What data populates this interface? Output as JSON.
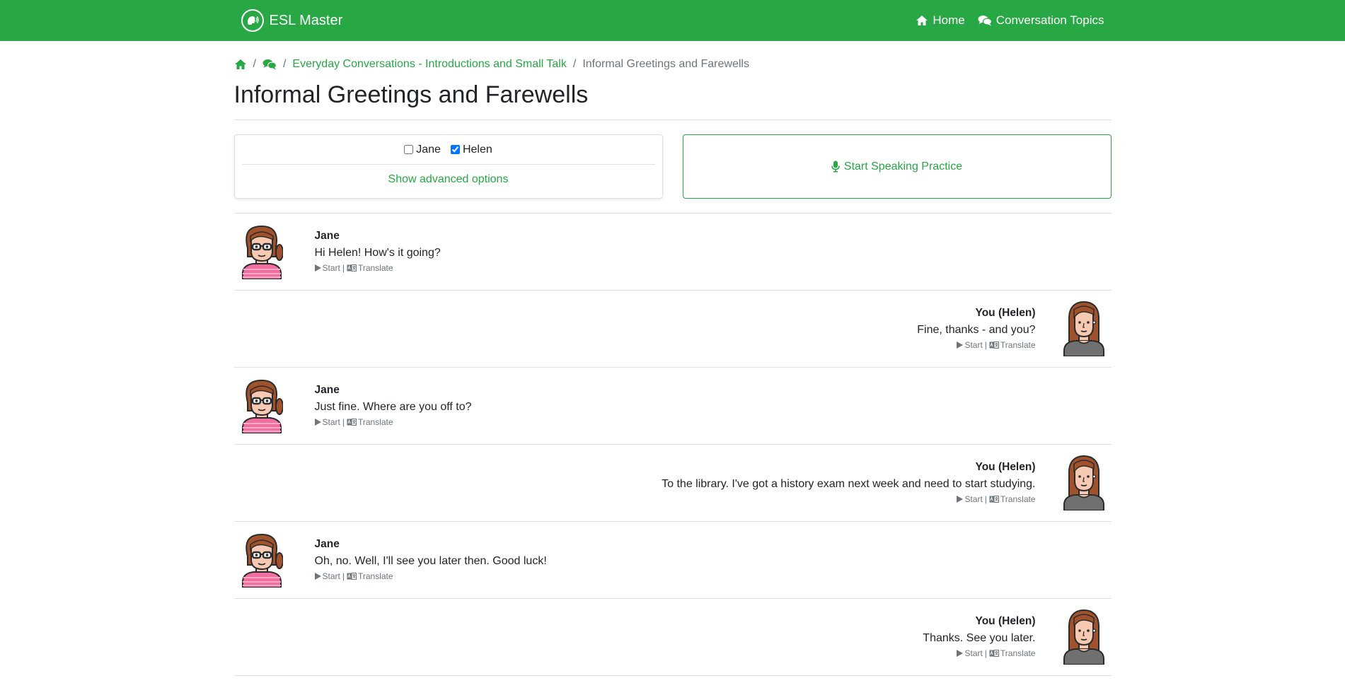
{
  "nav": {
    "brand": "ESL Master",
    "links": [
      {
        "label": "Home",
        "icon": "home-icon"
      },
      {
        "label": "Conversation Topics",
        "icon": "comments-icon"
      }
    ]
  },
  "breadcrumb": {
    "topic": "Everyday Conversations - Introductions and Small Talk",
    "current": "Informal Greetings and Farewells"
  },
  "page_title": "Informal Greetings and Farewells",
  "roles": [
    {
      "label": "Jane",
      "checked": false
    },
    {
      "label": "Helen",
      "checked": true
    }
  ],
  "advanced_label": "Show advanced options",
  "practice_label": "Start Speaking Practice",
  "actions": {
    "start": "Start",
    "separator": "|",
    "translate": "Translate"
  },
  "colors": {
    "accent": "#28a745",
    "muted": "#6c757d"
  },
  "dialog": [
    {
      "speaker": "Jane",
      "text": "Hi Helen! How's it going?"
    },
    {
      "speaker": "You (Helen)",
      "text": "Fine, thanks - and you?"
    },
    {
      "speaker": "Jane",
      "text": "Just fine. Where are you off to?"
    },
    {
      "speaker": "You (Helen)",
      "text": "To the library. I've got a history exam next week and need to start studying."
    },
    {
      "speaker": "Jane",
      "text": "Oh, no. Well, I'll see you later then. Good luck!"
    },
    {
      "speaker": "You (Helen)",
      "text": "Thanks. See you later."
    }
  ]
}
